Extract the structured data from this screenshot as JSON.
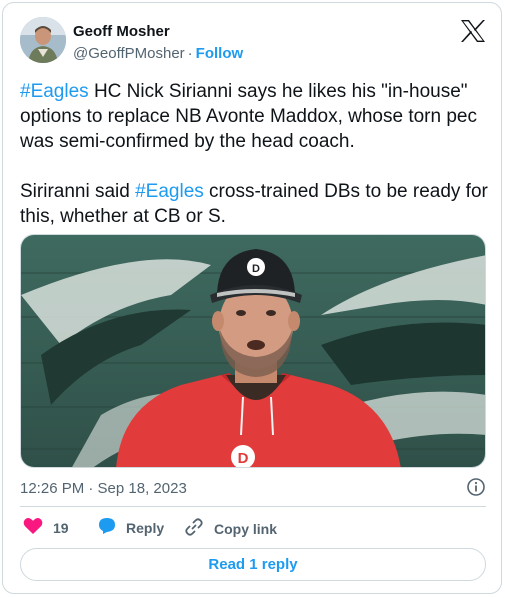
{
  "author": {
    "name": "Geoff Mosher",
    "handle": "@GeoffPMosher",
    "separator": "·",
    "follow_label": "Follow"
  },
  "tweet": {
    "p1_hashtag": "#Eagles",
    "p1_text": " HC Nick Sirianni says he likes his \"in-house\" options to replace NB Avonte Maddox, whose torn pec was semi-confirmed by the head coach.",
    "p2_before": "Siriranni said ",
    "p2_hashtag": "#Eagles",
    "p2_after": " cross-trained DBs to be ready for this, whether at CB or S."
  },
  "media": {
    "cap_logo": "D",
    "hoodie_logo": "D"
  },
  "timestamp": "12:26 PM · Sep 18, 2023",
  "actions": {
    "like_count": "19",
    "reply_label": "Reply",
    "copy_link_label": "Copy link"
  },
  "read_replies_label": "Read 1 reply",
  "colors": {
    "accent": "#1d9bf0",
    "like": "#f91880",
    "secondary_text": "#536471",
    "border": "#cfd9de"
  }
}
